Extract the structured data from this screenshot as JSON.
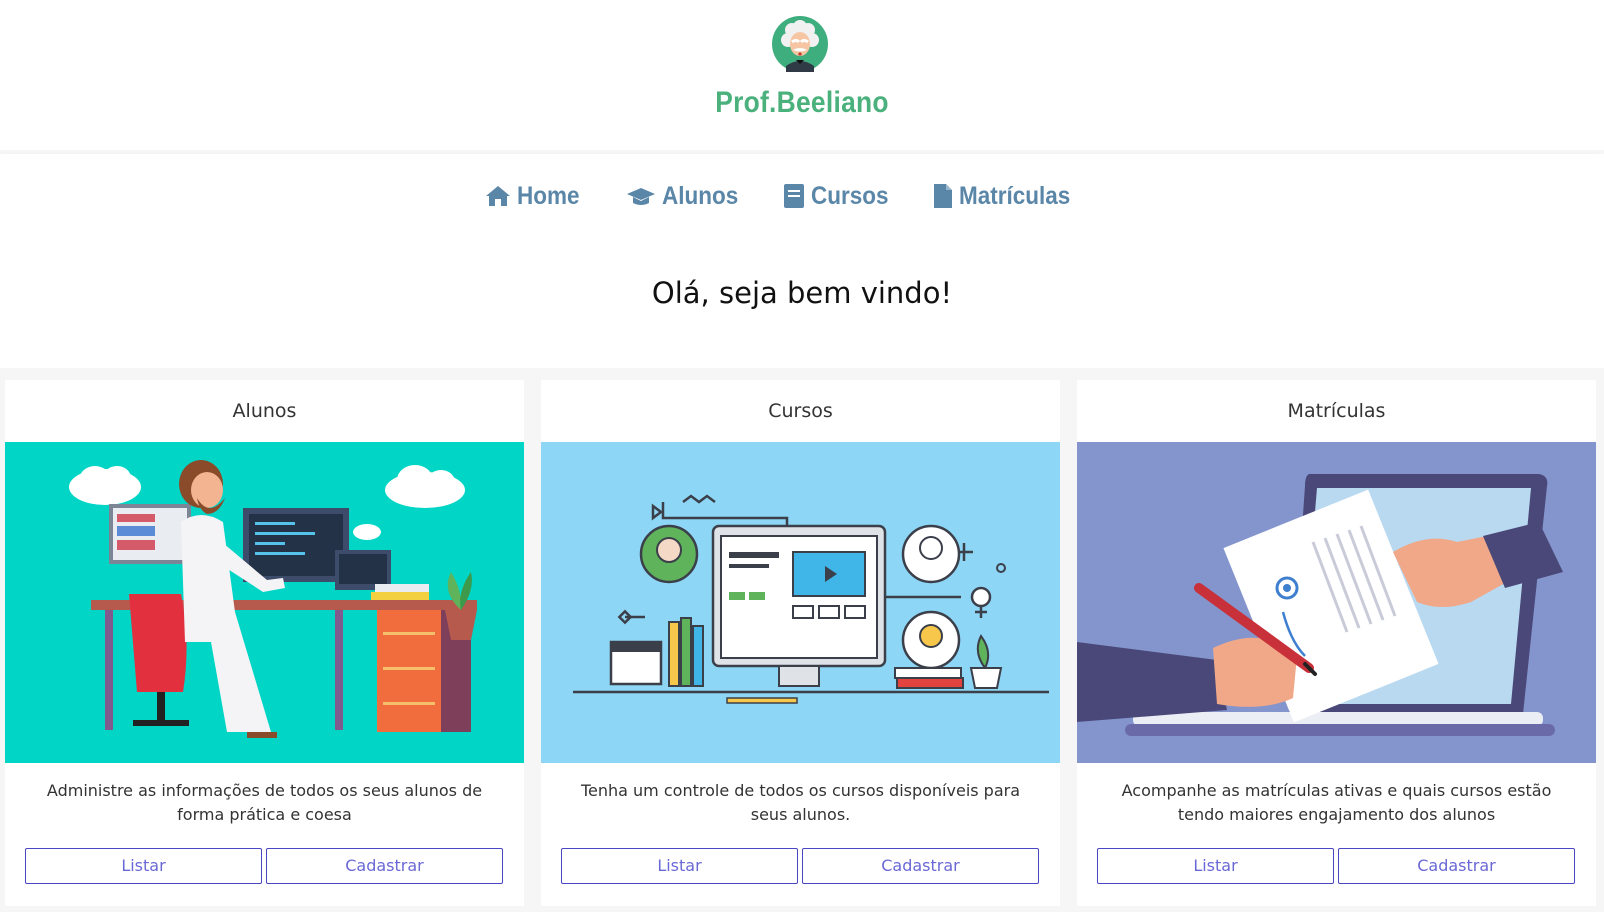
{
  "brand": {
    "name": "Prof.Beeliano",
    "logo_icon": "professor-avatar-icon",
    "color": "#4bb17c"
  },
  "nav": {
    "color": "#5a86a8",
    "items": [
      {
        "label": "Home",
        "icon": "home-icon"
      },
      {
        "label": "Alunos",
        "icon": "graduation-cap-icon"
      },
      {
        "label": "Cursos",
        "icon": "book-icon"
      },
      {
        "label": "Matrículas",
        "icon": "file-icon"
      }
    ]
  },
  "welcome": "Olá, seja bem vindo!",
  "cards": [
    {
      "title": "Alunos",
      "image": "student-programmer-illustration",
      "description": "Administre as informações de todos os seus alunos de forma prática e coesa",
      "list_label": "Listar",
      "create_label": "Cadastrar"
    },
    {
      "title": "Cursos",
      "image": "online-courses-illustration",
      "description": "Tenha um controle de todos os cursos disponíveis para seus alunos.",
      "list_label": "Listar",
      "create_label": "Cadastrar"
    },
    {
      "title": "Matrículas",
      "image": "enrollment-signature-illustration",
      "description": "Acompanhe as matrículas ativas e quais cursos estão tendo maiores engajamento dos alunos",
      "list_label": "Listar",
      "create_label": "Cadastrar"
    }
  ],
  "colors": {
    "button_border": "#4a47c4",
    "button_text": "#6a68d6"
  }
}
